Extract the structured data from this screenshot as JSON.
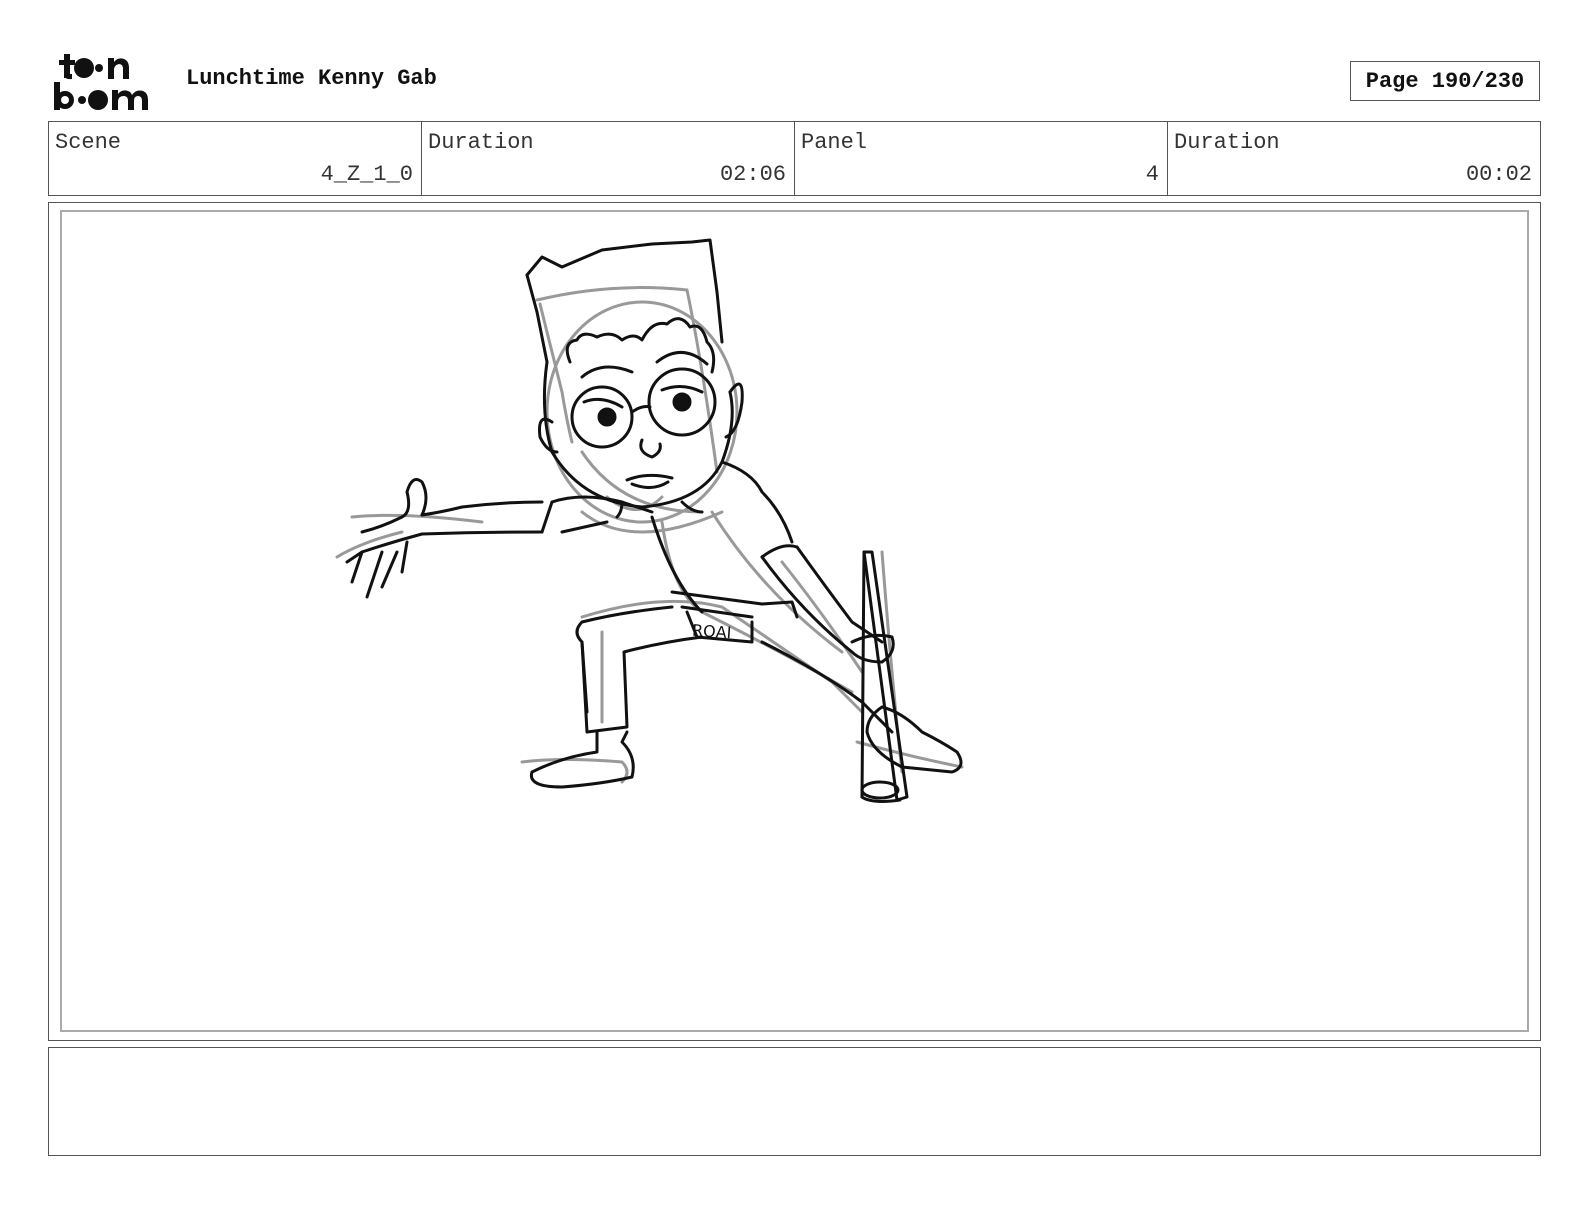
{
  "header": {
    "logo_text": "toon boom",
    "project_title": "Lunchtime Kenny Gab",
    "page_label": "Page 190/230"
  },
  "info": {
    "scene_label": "Scene",
    "scene_value": "4_Z_1_0",
    "scene_duration_label": "Duration",
    "scene_duration_value": "02:06",
    "panel_label": "Panel",
    "panel_value": "4",
    "panel_duration_label": "Duration",
    "panel_duration_value": "00:02"
  },
  "drawing": {
    "description_icon": "character-sketch",
    "shorts_lettering": "RQAI"
  },
  "notes": {
    "text": ""
  }
}
